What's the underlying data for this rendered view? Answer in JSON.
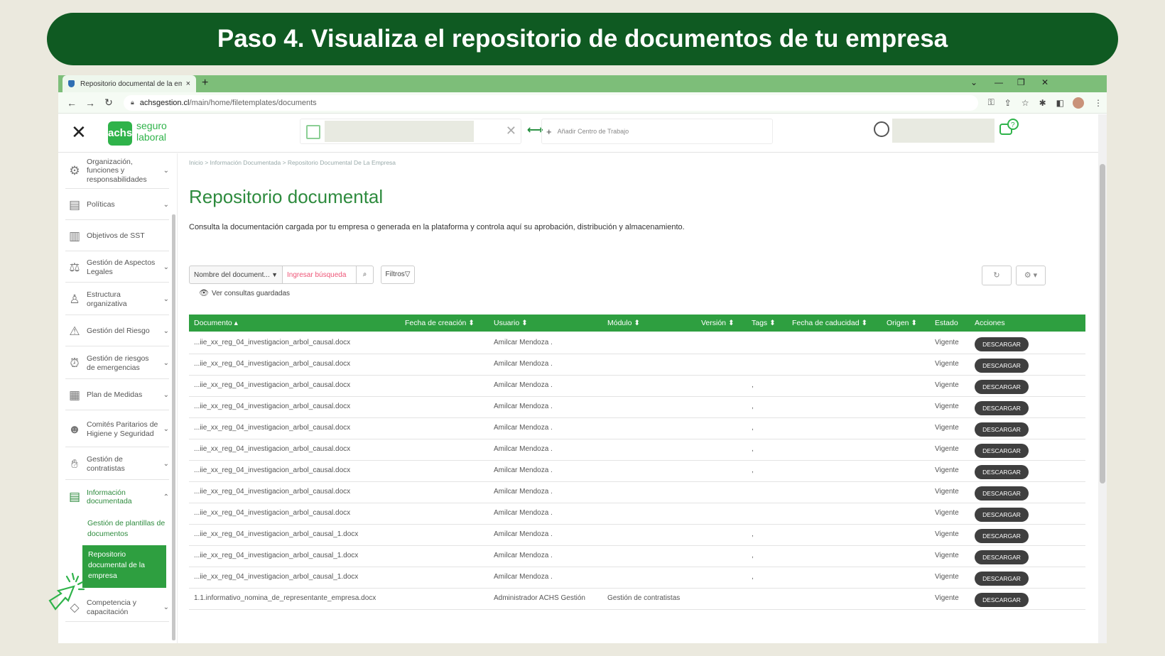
{
  "banner": {
    "title": "Paso 4. Visualiza el repositorio de documentos de tu empresa"
  },
  "browser": {
    "tab_title": "Repositorio documental de la em",
    "tab_close": "×",
    "new_tab": "+",
    "url_domain": "achsgestion.cl",
    "url_path": "/main/home/filetemplates/documents",
    "window_controls": [
      "⌄",
      "—",
      "❐",
      "✕"
    ]
  },
  "app": {
    "close": "✕",
    "logo_badge": "achs",
    "logo_line1": "seguro",
    "logo_line2": "laboral",
    "company_clear": "✕",
    "swap_icon": "⟷",
    "add_center_plus": "+",
    "add_center": "Añadir Centro de Trabajo"
  },
  "sidebar": {
    "items": [
      {
        "label": "Organización, funciones y responsabilidades",
        "icon": "org-icon"
      },
      {
        "label": "Políticas",
        "icon": "policy-icon"
      },
      {
        "label": "Objetivos de SST",
        "icon": "chart-icon"
      },
      {
        "label": "Gestión de Aspectos Legales",
        "icon": "scale-icon"
      },
      {
        "label": "Estructura organizativa",
        "icon": "structure-icon"
      },
      {
        "label": "Gestión del Riesgo",
        "icon": "warning-icon"
      },
      {
        "label": "Gestión de riesgos de emergencias",
        "icon": "alarm-icon"
      },
      {
        "label": "Plan de Medidas",
        "icon": "clipboard-icon"
      },
      {
        "label": "Comités Paritarios de Higiene y Seguridad",
        "icon": "people-icon"
      },
      {
        "label": "Gestión de contratistas",
        "icon": "handshake-icon"
      },
      {
        "label": "Información documentada",
        "icon": "document-icon"
      },
      {
        "label": "Competencia y capacitación",
        "icon": "cap-icon"
      }
    ],
    "sub_items": [
      "Gestión de plantillas de documentos",
      "Repositorio documental de la empresa"
    ]
  },
  "content": {
    "breadcrumb": "Inicio > Información Documentada > Repositorio Documental De La Empresa",
    "title": "Repositorio documental",
    "subtitle": "Consulta la documentación cargada por tu empresa o generada en la plataforma y controla aquí su aprobación, distribución y almacenamiento.",
    "search_field": "Nombre del document...",
    "search_placeholder": "Ingresar búsqueda",
    "filters_label": "Filtros",
    "saved_queries": "Ver consultas guardadas"
  },
  "table": {
    "headers": {
      "documento": "Documento ▴",
      "fecha": "Fecha de creación ⬍",
      "usuario": "Usuario ⬍",
      "modulo": "Módulo ⬍",
      "version": "Versión ⬍",
      "tags": "Tags ⬍",
      "caducidad": "Fecha de caducidad ⬍",
      "origen": "Origen ⬍",
      "estado": "Estado",
      "acciones": "Acciones"
    },
    "action_label": "DESCARGAR",
    "rows": [
      {
        "doc": "...iie_xx_reg_04_investigacion_arbol_causal.docx",
        "user": "Amilcar Mendoza .",
        "module": "",
        "tags": "",
        "state": "Vigente"
      },
      {
        "doc": "...iie_xx_reg_04_investigacion_arbol_causal.docx",
        "user": "Amilcar Mendoza .",
        "module": "",
        "tags": "",
        "state": "Vigente"
      },
      {
        "doc": "...iie_xx_reg_04_investigacion_arbol_causal.docx",
        "user": "Amilcar Mendoza .",
        "module": "",
        "tags": ",",
        "state": "Vigente"
      },
      {
        "doc": "...iie_xx_reg_04_investigacion_arbol_causal.docx",
        "user": "Amilcar Mendoza .",
        "module": "",
        "tags": ",",
        "state": "Vigente"
      },
      {
        "doc": "...iie_xx_reg_04_investigacion_arbol_causal.docx",
        "user": "Amilcar Mendoza .",
        "module": "",
        "tags": ",",
        "state": "Vigente"
      },
      {
        "doc": "...iie_xx_reg_04_investigacion_arbol_causal.docx",
        "user": "Amilcar Mendoza .",
        "module": "",
        "tags": ",",
        "state": "Vigente"
      },
      {
        "doc": "...iie_xx_reg_04_investigacion_arbol_causal.docx",
        "user": "Amilcar Mendoza .",
        "module": "",
        "tags": ",",
        "state": "Vigente"
      },
      {
        "doc": "...iie_xx_reg_04_investigacion_arbol_causal.docx",
        "user": "Amilcar Mendoza .",
        "module": "",
        "tags": "",
        "state": "Vigente"
      },
      {
        "doc": "...iie_xx_reg_04_investigacion_arbol_causal.docx",
        "user": "Amilcar Mendoza .",
        "module": "",
        "tags": "",
        "state": "Vigente"
      },
      {
        "doc": "...iie_xx_reg_04_investigacion_arbol_causal_1.docx",
        "user": "Amilcar Mendoza .",
        "module": "",
        "tags": ",",
        "state": "Vigente"
      },
      {
        "doc": "...iie_xx_reg_04_investigacion_arbol_causal_1.docx",
        "user": "Amilcar Mendoza .",
        "module": "",
        "tags": ",",
        "state": "Vigente"
      },
      {
        "doc": "...iie_xx_reg_04_investigacion_arbol_causal_1.docx",
        "user": "Amilcar Mendoza .",
        "module": "",
        "tags": ",",
        "state": "Vigente"
      },
      {
        "doc": "1.1.informativo_nomina_de_representante_empresa.docx",
        "user": "Administrador ACHS Gestión",
        "module": "Gestión de contratistas",
        "tags": "",
        "state": "Vigente"
      }
    ]
  },
  "colors": {
    "banner": "#0f5a22",
    "brand": "#2fb34a",
    "header_row": "#2e9f40",
    "button": "#3f3f3f"
  }
}
